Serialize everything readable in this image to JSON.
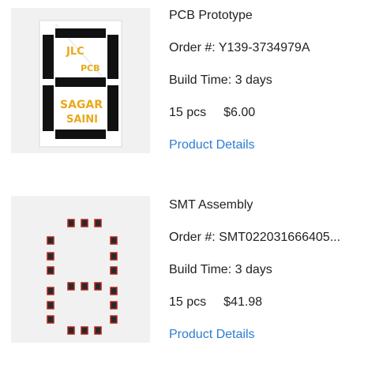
{
  "orders": [
    {
      "product_name": "PCB Prototype",
      "order_label": "Order #:",
      "order_number": "Y139-3734979A",
      "build_time_label": "Build Time:",
      "build_time": "3 days",
      "quantity": "15 pcs",
      "price": "$6.00",
      "details_link": "Product Details",
      "thumbnail": {
        "text_lines": [
          "JLC",
          "PCB",
          "SAGAR",
          "SAINI"
        ]
      }
    },
    {
      "product_name": "SMT Assembly",
      "order_label": "Order #:",
      "order_number": "SMT022031666405...",
      "build_time_label": "Build Time:",
      "build_time": "3 days",
      "quantity": "15 pcs",
      "price": "$41.98",
      "details_link": "Product Details"
    }
  ],
  "colors": {
    "link": "#2d7dd2",
    "text": "#222222",
    "thumb_bg": "#f1f1f1",
    "silkscreen": "#e8a91b",
    "segment": "#111111",
    "smt_pad": "#b3261e"
  }
}
